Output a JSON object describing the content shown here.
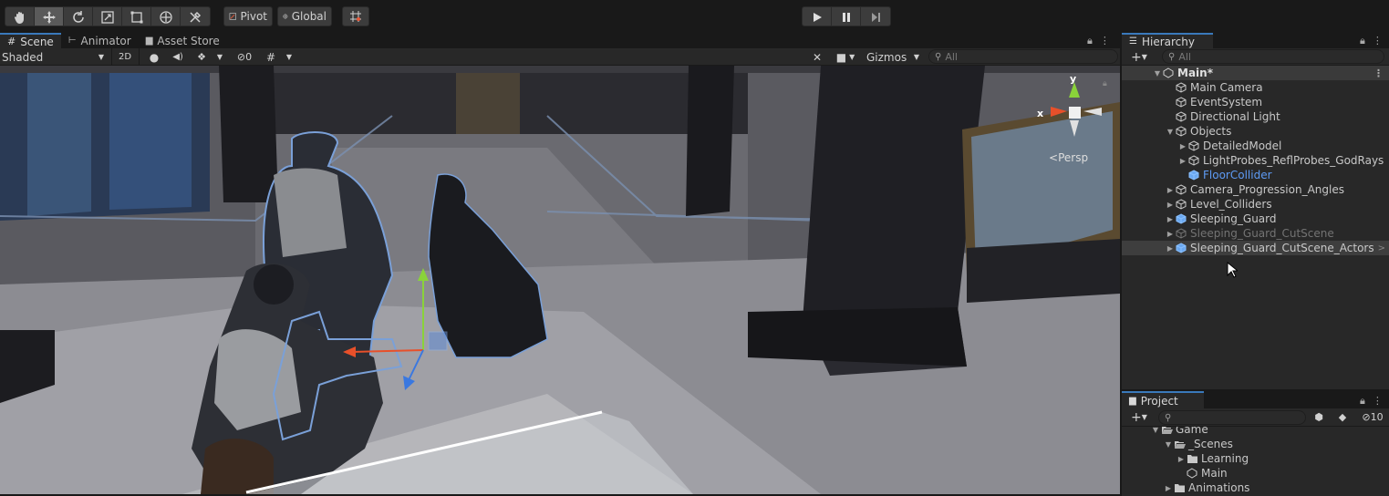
{
  "toolbar": {
    "pivot_label": "Pivot",
    "global_label": "Global",
    "tools": [
      "hand-icon",
      "move-icon",
      "rotate-icon",
      "scale-icon",
      "rect-icon",
      "transform-icon",
      "custom-tool-icon"
    ]
  },
  "scene_tabs": [
    {
      "label": "Scene",
      "icon": "grid-icon"
    },
    {
      "label": "Animator",
      "icon": "animator-icon"
    },
    {
      "label": "Asset Store",
      "icon": "bag-icon"
    }
  ],
  "scene_toolbar": {
    "shading_mode": "Shaded",
    "mode_2d": "2D",
    "hidden_count": "0",
    "gizmos_label": "Gizmos",
    "search_placeholder": "All"
  },
  "viewport": {
    "persp_label": "Persp",
    "axis_x": "x",
    "axis_y": "y"
  },
  "hierarchy": {
    "tab_label": "Hierarchy",
    "search_placeholder": "All",
    "scene_name": "Main*",
    "items": [
      {
        "label": "Main Camera",
        "depth": 1,
        "arrow": "",
        "state": "normal"
      },
      {
        "label": "EventSystem",
        "depth": 1,
        "arrow": "",
        "state": "normal"
      },
      {
        "label": "Directional Light",
        "depth": 1,
        "arrow": "",
        "state": "normal"
      },
      {
        "label": "Objects",
        "depth": 1,
        "arrow": "▼",
        "state": "normal"
      },
      {
        "label": "DetailedModel",
        "depth": 2,
        "arrow": "▶",
        "state": "normal"
      },
      {
        "label": "LightProbes_ReflProbes_GodRays",
        "depth": 2,
        "arrow": "▶",
        "state": "normal"
      },
      {
        "label": "FloorCollider",
        "depth": 2,
        "arrow": "",
        "state": "blue"
      },
      {
        "label": "Camera_Progression_Angles",
        "depth": 1,
        "arrow": "▶",
        "state": "normal"
      },
      {
        "label": "Level_Colliders",
        "depth": 1,
        "arrow": "▶",
        "state": "normal"
      },
      {
        "label": "Sleeping_Guard",
        "depth": 1,
        "arrow": "▶",
        "state": "prefab"
      },
      {
        "label": "Sleeping_Guard_CutScene",
        "depth": 1,
        "arrow": "▶",
        "state": "dim"
      },
      {
        "label": "Sleeping_Guard_CutScene_Actors",
        "depth": 1,
        "arrow": "▶",
        "state": "selected"
      }
    ]
  },
  "project": {
    "tab_label": "Project",
    "hidden_count": "10",
    "items": [
      {
        "label": "Game",
        "depth": 0,
        "arrow": "▼",
        "icon": "open-folder-icon"
      },
      {
        "label": "_Scenes",
        "depth": 1,
        "arrow": "▼",
        "icon": "open-folder-icon"
      },
      {
        "label": "Learning",
        "depth": 2,
        "arrow": "▶",
        "icon": "folder-icon"
      },
      {
        "label": "Main",
        "depth": 2,
        "arrow": "",
        "icon": "unity-scene-icon"
      },
      {
        "label": "Animations",
        "depth": 1,
        "arrow": "▶",
        "icon": "folder-icon"
      }
    ]
  },
  "colors": {
    "accent": "#3a79bb",
    "selected_blue": "#5e9bf5",
    "panel_bg": "#282828"
  }
}
